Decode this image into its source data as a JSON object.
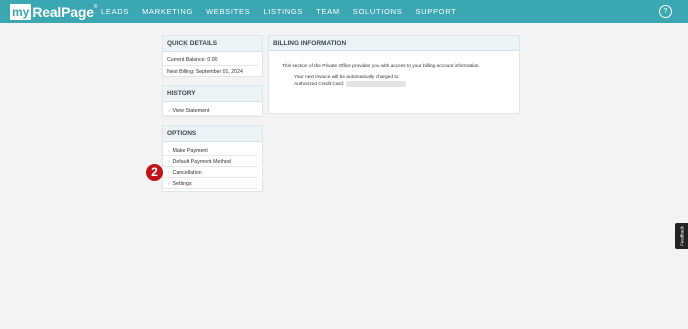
{
  "app": {
    "logo": {
      "prefix": "my",
      "name": "RealPage",
      "trademark": "®"
    },
    "nav": [
      "LEADS",
      "MARKETING",
      "WEBSITES",
      "LISTINGS",
      "TEAM",
      "SOLUTIONS",
      "SUPPORT"
    ],
    "help_label": "?",
    "accent_color": "#3aa7b3"
  },
  "quick_details": {
    "title": "QUICK DETAILS",
    "current_balance": "Current Balance: 0.00",
    "next_billing": "Next Billing: September 01, 2024"
  },
  "history": {
    "title": "HISTORY",
    "items": [
      "View Statement"
    ]
  },
  "options": {
    "title": "OPTIONS",
    "items": [
      "Make Payment",
      "Default Payment Method",
      "Cancellation",
      "Settings"
    ]
  },
  "billing": {
    "title": "BILLING INFORMATION",
    "description": "This section of the Private Office provides you with access to your billing account information.",
    "invoice_line": "Your next invoice will be automatically charged to:",
    "card_label": "Authorized Credit Card:"
  },
  "step_badge": "2",
  "feedback_label": "Feedback",
  "icons": {
    "list_bullet": "chevron-right-icon",
    "help": "help-icon"
  }
}
